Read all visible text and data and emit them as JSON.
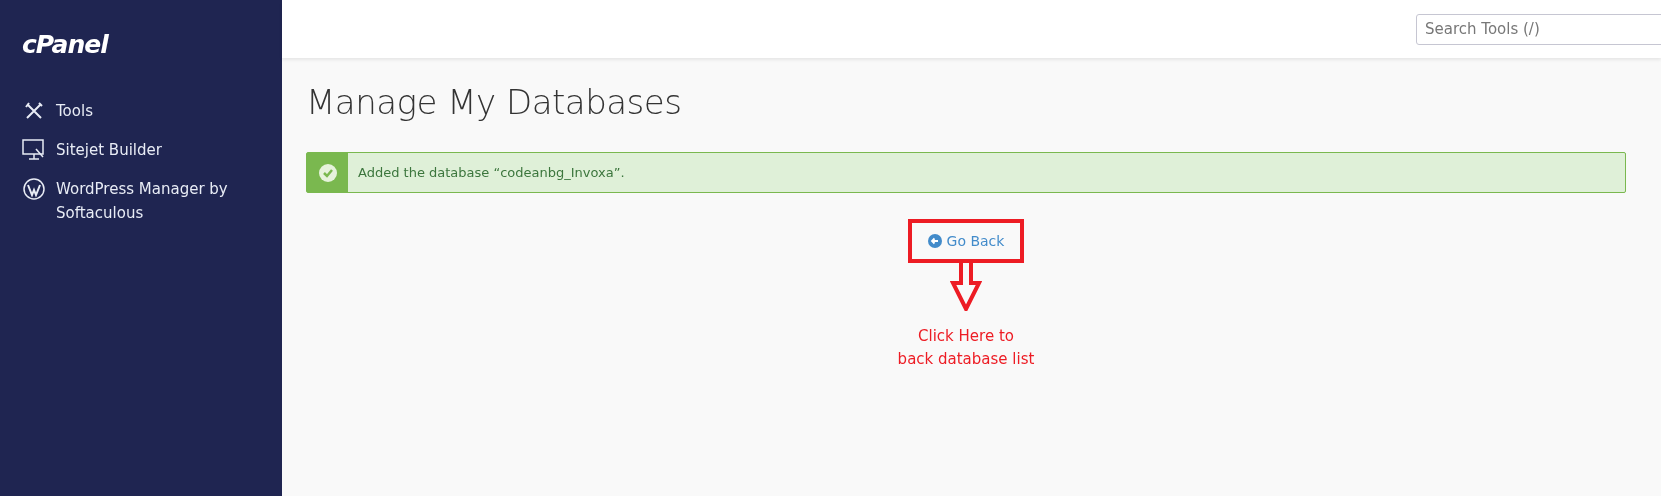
{
  "sidebar": {
    "logo": "cPanel",
    "items": [
      {
        "label": "Tools",
        "selected": false
      },
      {
        "label": "Sitejet Builder",
        "selected": false
      },
      {
        "label": "WordPress Manager by Softaculous",
        "selected": false
      }
    ]
  },
  "header": {
    "search": {
      "placeholder": "Search Tools (/)"
    }
  },
  "page": {
    "title": "Manage My Databases",
    "alert": {
      "kind": "success",
      "message": "Added the database “codeanbg_Invoxa”."
    },
    "go_back": "Go Back",
    "annotation": "Click Here to\nback database list"
  }
}
